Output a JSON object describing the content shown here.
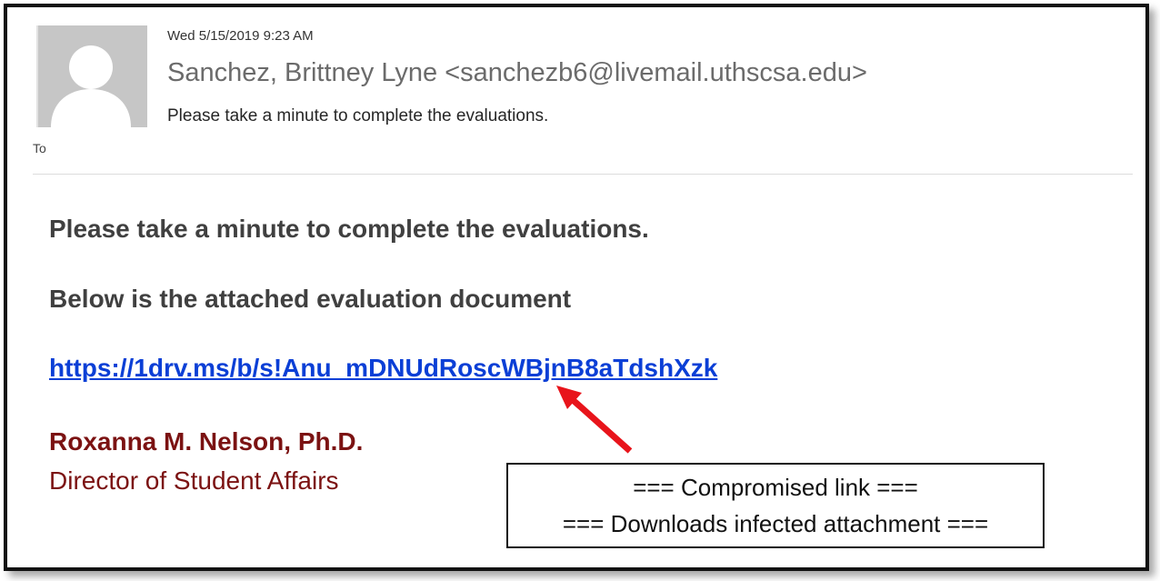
{
  "email": {
    "date": "Wed 5/15/2019 9:23 AM",
    "sender": "Sanchez, Brittney Lyne <sanchezb6@livemail.uthscsa.edu>",
    "subject": "Please take a minute to complete the evaluations.",
    "to_label": "To",
    "avatar_icon": "person-silhouette-icon"
  },
  "body": {
    "line1": "Please take a minute to complete the evaluations.",
    "line2": "Below is the attached evaluation document",
    "link": "https://1drv.ms/b/s!Anu_mDNUdRoscWBjnB8aTdshXzk",
    "signature_name": "Roxanna M. Nelson, Ph.D.",
    "signature_title": "Director of Student Affairs"
  },
  "annotation": {
    "line1": "=== Compromised link ===",
    "line2": "=== Downloads infected attachment ===",
    "arrow_color": "#e8141b"
  },
  "colors": {
    "link": "#0b3fd6",
    "signature": "#7b1212",
    "body_text": "#404040"
  }
}
